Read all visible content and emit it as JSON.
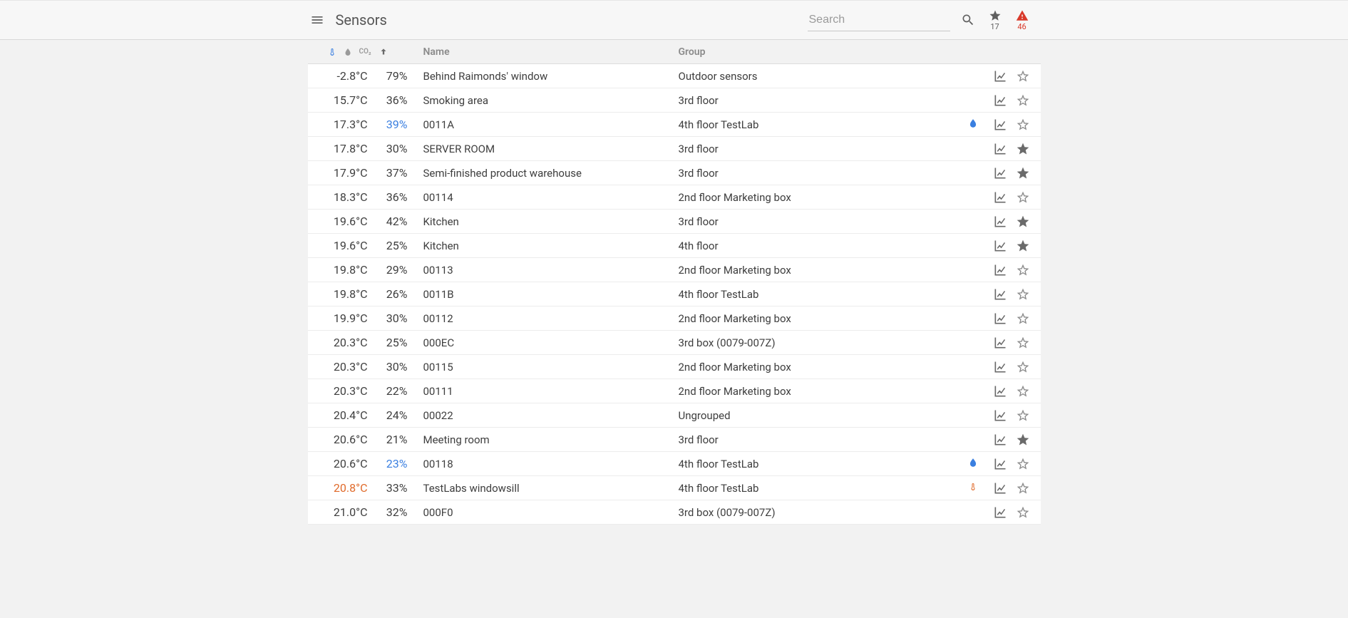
{
  "header": {
    "title": "Sensors",
    "search_placeholder": "Search",
    "fav_count": "17",
    "alert_count": "46"
  },
  "table": {
    "headers": {
      "name": "Name",
      "group": "Group",
      "co2": "CO₂"
    },
    "rows": [
      {
        "temp": "-2.8°C",
        "hum": "79%",
        "name": "Behind Raimonds' window",
        "group": "Outdoor sensors",
        "fav": false,
        "ind": ""
      },
      {
        "temp": "15.7°C",
        "hum": "36%",
        "name": "Smoking area",
        "group": "3rd floor",
        "fav": false,
        "ind": ""
      },
      {
        "temp": "17.3°C",
        "hum": "39%",
        "hum_class": "hum-blue",
        "name": "0011A",
        "group": "4th floor TestLab",
        "fav": false,
        "ind": "drop"
      },
      {
        "temp": "17.8°C",
        "hum": "30%",
        "name": "SERVER ROOM",
        "group": "3rd floor",
        "fav": true,
        "ind": ""
      },
      {
        "temp": "17.9°C",
        "hum": "37%",
        "name": "Semi-finished product warehouse",
        "group": "3rd floor",
        "fav": true,
        "ind": ""
      },
      {
        "temp": "18.3°C",
        "hum": "36%",
        "name": "00114",
        "group": "2nd floor Marketing box",
        "fav": false,
        "ind": ""
      },
      {
        "temp": "19.6°C",
        "hum": "42%",
        "name": "Kitchen",
        "group": "3rd floor",
        "fav": true,
        "ind": ""
      },
      {
        "temp": "19.6°C",
        "hum": "25%",
        "name": "Kitchen",
        "group": "4th floor",
        "fav": true,
        "ind": ""
      },
      {
        "temp": "19.8°C",
        "hum": "29%",
        "name": "00113",
        "group": "2nd floor Marketing box",
        "fav": false,
        "ind": ""
      },
      {
        "temp": "19.8°C",
        "hum": "26%",
        "name": "0011B",
        "group": "4th floor TestLab",
        "fav": false,
        "ind": ""
      },
      {
        "temp": "19.9°C",
        "hum": "30%",
        "name": "00112",
        "group": "2nd floor Marketing box",
        "fav": false,
        "ind": ""
      },
      {
        "temp": "20.3°C",
        "hum": "25%",
        "name": "000EC",
        "group": "3rd box (0079-007Z)",
        "fav": false,
        "ind": ""
      },
      {
        "temp": "20.3°C",
        "hum": "30%",
        "name": "00115",
        "group": "2nd floor Marketing box",
        "fav": false,
        "ind": ""
      },
      {
        "temp": "20.3°C",
        "hum": "22%",
        "name": "00111",
        "group": "2nd floor Marketing box",
        "fav": false,
        "ind": ""
      },
      {
        "temp": "20.4°C",
        "hum": "24%",
        "name": "00022",
        "group": "Ungrouped",
        "fav": false,
        "ind": ""
      },
      {
        "temp": "20.6°C",
        "hum": "21%",
        "name": "Meeting room",
        "group": "3rd floor",
        "fav": true,
        "ind": ""
      },
      {
        "temp": "20.6°C",
        "hum": "23%",
        "hum_class": "hum-blue",
        "name": "00118",
        "group": "4th floor TestLab",
        "fav": false,
        "ind": "drop"
      },
      {
        "temp": "20.8°C",
        "temp_class": "temp-orange",
        "hum": "33%",
        "name": "TestLabs windowsill",
        "group": "4th floor TestLab",
        "fav": false,
        "ind": "therm"
      },
      {
        "temp": "21.0°C",
        "hum": "32%",
        "name": "000F0",
        "group": "3rd box (0079-007Z)",
        "fav": false,
        "ind": ""
      }
    ]
  }
}
